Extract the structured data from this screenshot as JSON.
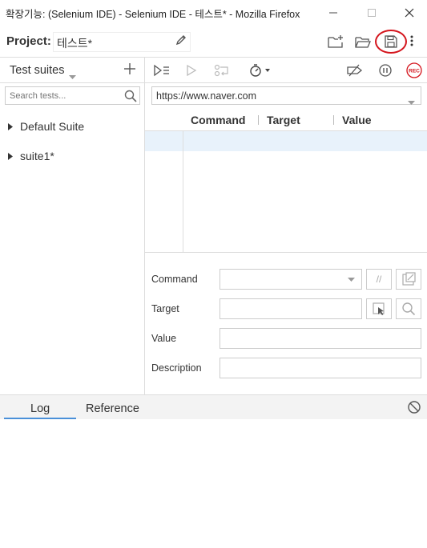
{
  "window": {
    "title": "확장기능: (Selenium IDE) - Selenium IDE - 테스트* - Mozilla Firefox"
  },
  "project": {
    "label": "Project:",
    "name": "테스트*"
  },
  "header_icons": [
    "new-folder-icon",
    "open-folder-icon",
    "save-icon",
    "more-options-icon"
  ],
  "sidebar": {
    "header_label": "Test suites",
    "search_placeholder": "Search tests...",
    "suites": [
      {
        "label": "Default Suite"
      },
      {
        "label": "suite1*"
      }
    ]
  },
  "toolbar": {
    "url": "https://www.naver.com",
    "rec_label": "REC",
    "icons": [
      "run-all-tests-icon",
      "run-current-test-icon",
      "step-over-icon",
      "test-execution-speed-icon",
      "disable-breakpoints-icon",
      "pause-on-exceptions-icon",
      "record-icon"
    ]
  },
  "table": {
    "columns": [
      "Command",
      "Target",
      "Value"
    ]
  },
  "editor": {
    "command_label": "Command",
    "target_label": "Target",
    "value_label": "Value",
    "description_label": "Description",
    "comment_toggle": "//"
  },
  "bottom": {
    "tabs": [
      {
        "label": "Log",
        "active": true
      },
      {
        "label": "Reference",
        "active": false
      }
    ]
  },
  "colors": {
    "accent": "#4a90d9",
    "highlight_circle": "#d4141c",
    "rec_red": "#d4141c",
    "selected_row": "#e8f2fb"
  }
}
